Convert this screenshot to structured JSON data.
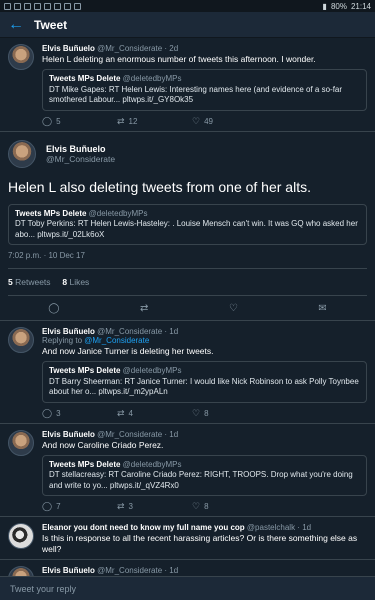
{
  "status": {
    "battery": "80%",
    "time": "21:14"
  },
  "header": {
    "title": "Tweet"
  },
  "parent_tweet": {
    "name": "Elvis Buñuelo",
    "handle": "@Mr_Considerate",
    "time": "2d",
    "text": "Helen L deleting an enormous number of tweets this afternoon. I wonder.",
    "quote": {
      "name": "Tweets MPs Delete",
      "handle": "@deletedbyMPs",
      "text": "DT Mike Gapes: RT Helen Lewis: Interesting names here (and evidence of a so-far smothered Labour... pltwps.it/_GY8Ok35"
    },
    "replies": "5",
    "retweets": "12",
    "likes": "49"
  },
  "main_tweet": {
    "name": "Elvis Buñuelo",
    "handle": "@Mr_Considerate",
    "text": "Helen L also deleting tweets from one of her alts.",
    "quote": {
      "name": "Tweets MPs Delete",
      "handle": "@deletedbyMPs",
      "text": "DT Toby Perkins: RT Helen Lewis-Hasteley: . Louise Mensch can't win. It was GQ who asked her abo... pltwps.it/_02Lk6oX"
    },
    "timestamp": "7:02 p.m. · 10 Dec 17",
    "retweets_count": "5",
    "retweets_label": "Retweets",
    "likes_count": "8",
    "likes_label": "Likes"
  },
  "replies": [
    {
      "name": "Elvis Buñuelo",
      "handle": "@Mr_Considerate",
      "time": "1d",
      "reply_prefix": "Replying to",
      "reply_to": "@Mr_Considerate",
      "text": "And now Janice Turner is deleting her tweets.",
      "quote": {
        "name": "Tweets MPs Delete",
        "handle": "@deletedbyMPs",
        "text": "DT Barry Sheerman: RT Janice Turner: I would like Nick Robinson to ask Polly Toynbee about her o... pltwps.it/_m2ypALn"
      },
      "replies": "3",
      "retweets": "4",
      "likes": "8"
    },
    {
      "name": "Elvis Buñuelo",
      "handle": "@Mr_Considerate",
      "time": "1d",
      "text": "And now Caroline Criado Perez.",
      "quote": {
        "name": "Tweets MPs Delete",
        "handle": "@deletedbyMPs",
        "text": "DT stellacreasy: RT Caroline Criado Perez: RIGHT, TROOPS. Drop what you're doing and write to yo... pltwps.it/_qVZ4Rx0"
      },
      "replies": "7",
      "retweets": "3",
      "likes": "8"
    },
    {
      "name": "Eleanor you dont need to know my full name you cop",
      "handle": "@pastelchalk",
      "time": "1d",
      "text": "Is this in response to all the recent harassing articles? Or is there something else as well?"
    },
    {
      "name": "Elvis Buñuelo",
      "handle": "@Mr_Considerate",
      "time": "1d"
    }
  ],
  "reply_bar": {
    "placeholder": "Tweet your reply"
  }
}
